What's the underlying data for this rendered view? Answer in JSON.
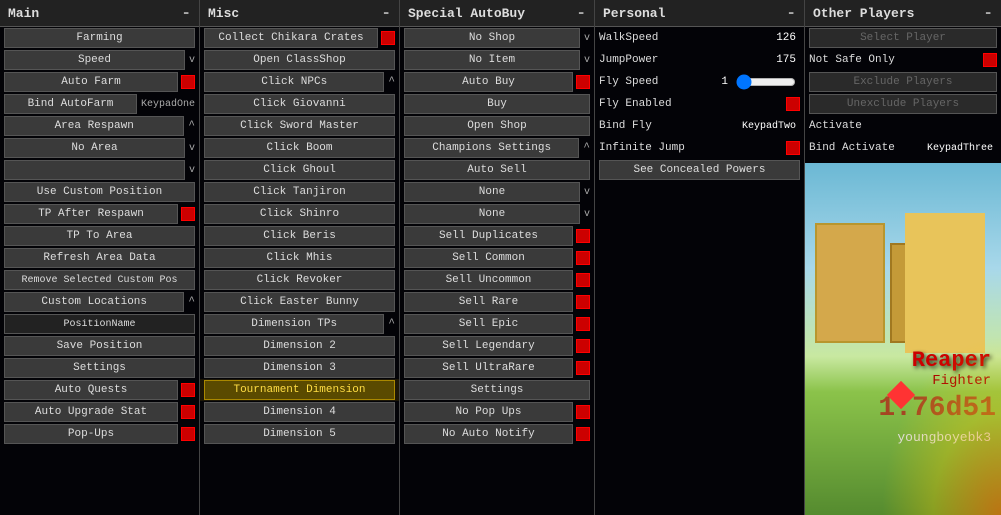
{
  "panels": {
    "main": {
      "header": "Main",
      "minus": "-",
      "buttons": [
        {
          "label": "Farming",
          "type": "btn"
        },
        {
          "label": "Speed",
          "type": "btn-v",
          "suffix": "v"
        },
        {
          "label": "Auto Farm",
          "type": "btn-red"
        },
        {
          "label": "Bind AutoFarm",
          "type": "btn-key",
          "key": "KeypadOne"
        },
        {
          "label": "Area Respawn",
          "type": "btn-caret",
          "caret": "^"
        },
        {
          "label": "No Area",
          "type": "btn-v",
          "suffix": "v"
        },
        {
          "label": "",
          "type": "btn-v",
          "suffix": "v"
        },
        {
          "label": "Use Custom Position",
          "type": "btn"
        },
        {
          "label": "TP After Respawn",
          "type": "btn-red"
        },
        {
          "label": "TP To Area",
          "type": "btn"
        },
        {
          "label": "Refresh Area Data",
          "type": "btn"
        },
        {
          "label": "Remove Selected Custom Pos",
          "type": "btn"
        },
        {
          "label": "Custom Locations",
          "type": "btn-caret",
          "caret": "^"
        },
        {
          "label": "PositionName",
          "type": "input"
        },
        {
          "label": "Save Position",
          "type": "btn"
        },
        {
          "label": "Settings",
          "type": "btn"
        },
        {
          "label": "Auto Quests",
          "type": "btn-red"
        },
        {
          "label": "Auto Upgrade Stat",
          "type": "btn-red"
        },
        {
          "label": "Pop-Ups",
          "type": "btn-red"
        }
      ]
    },
    "misc": {
      "header": "Misc",
      "minus": "-",
      "buttons": [
        {
          "label": "Collect Chikara Crates",
          "type": "btn-red"
        },
        {
          "label": "Open ClassShop",
          "type": "btn"
        },
        {
          "label": "Click NPCs",
          "type": "btn-caret",
          "caret": "^"
        },
        {
          "label": "Click Giovanni",
          "type": "btn"
        },
        {
          "label": "Click Sword Master",
          "type": "btn"
        },
        {
          "label": "Click Boom",
          "type": "btn"
        },
        {
          "label": "Click Ghoul",
          "type": "btn"
        },
        {
          "label": "Click Tanjiron",
          "type": "btn"
        },
        {
          "label": "Click Shinro",
          "type": "btn"
        },
        {
          "label": "Click Beris",
          "type": "btn"
        },
        {
          "label": "Click Mhis",
          "type": "btn"
        },
        {
          "label": "Click Revoker",
          "type": "btn"
        },
        {
          "label": "Click Easter Bunny",
          "type": "btn"
        },
        {
          "label": "Dimension TPs",
          "type": "btn-caret",
          "caret": "^"
        },
        {
          "label": "Dimension 2",
          "type": "btn"
        },
        {
          "label": "Dimension 3",
          "type": "btn"
        },
        {
          "label": "Tournament Dimension",
          "type": "btn-highlight"
        },
        {
          "label": "Dimension 4",
          "type": "btn"
        },
        {
          "label": "Dimension 5",
          "type": "btn"
        }
      ]
    },
    "special": {
      "header": "Special AutoBuy",
      "minus": "-",
      "buttons": [
        {
          "label": "No Shop",
          "type": "btn-v",
          "suffix": "v"
        },
        {
          "label": "No Item",
          "type": "btn-v",
          "suffix": "v"
        },
        {
          "label": "Auto Buy",
          "type": "btn-red"
        },
        {
          "label": "Buy",
          "type": "btn"
        },
        {
          "label": "Open Shop",
          "type": "btn"
        },
        {
          "label": "Champions Settings",
          "type": "btn-caret",
          "caret": "^"
        },
        {
          "label": "Auto Sell",
          "type": "btn"
        },
        {
          "label": "None",
          "type": "btn-v",
          "suffix": "v"
        },
        {
          "label": "None",
          "type": "btn-v",
          "suffix": "v"
        },
        {
          "label": "Sell Duplicates",
          "type": "btn-red"
        },
        {
          "label": "Sell Common",
          "type": "btn-red"
        },
        {
          "label": "Sell Uncommon",
          "type": "btn-red"
        },
        {
          "label": "Sell Rare",
          "type": "btn-red"
        },
        {
          "label": "Sell Epic",
          "type": "btn-red"
        },
        {
          "label": "Sell Legendary",
          "type": "btn-red"
        },
        {
          "label": "Sell UltraRare",
          "type": "btn-red"
        },
        {
          "label": "Settings",
          "type": "btn"
        },
        {
          "label": "No Pop Ups",
          "type": "btn-red"
        },
        {
          "label": "No Auto Notify",
          "type": "btn-red"
        }
      ]
    },
    "personal": {
      "header": "Personal",
      "minus": "-",
      "rows": [
        {
          "label": "WalkSpeed",
          "value": "126",
          "type": "value"
        },
        {
          "label": "JumpPower",
          "value": "175",
          "type": "value"
        },
        {
          "label": "Fly Speed",
          "value": "1",
          "type": "slider"
        },
        {
          "label": "Fly Enabled",
          "type": "red-toggle"
        },
        {
          "label": "Bind Fly",
          "key": "KeypadTwo",
          "type": "keybind"
        },
        {
          "label": "Infinite Jump",
          "type": "red-toggle"
        },
        {
          "label": "See Concealed Powers",
          "type": "btn"
        }
      ]
    },
    "other": {
      "header": "Other Players",
      "minus": "-",
      "rows": [
        {
          "label": "Select Player",
          "type": "disabled-btn"
        },
        {
          "label": "Not Safe Only",
          "type": "red-toggle"
        },
        {
          "label": "Exclude Players",
          "type": "disabled-btn"
        },
        {
          "label": "Unexclude Players",
          "type": "disabled-btn"
        },
        {
          "label": "Activate",
          "type": "plain"
        },
        {
          "label": "Bind Activate",
          "key": "KeypadThree",
          "type": "keybind"
        }
      ]
    }
  },
  "game": {
    "reaper_label": "Reaper",
    "fighter_label": "Fighter",
    "version": "1.76d51",
    "username": "youngboyebk3"
  }
}
